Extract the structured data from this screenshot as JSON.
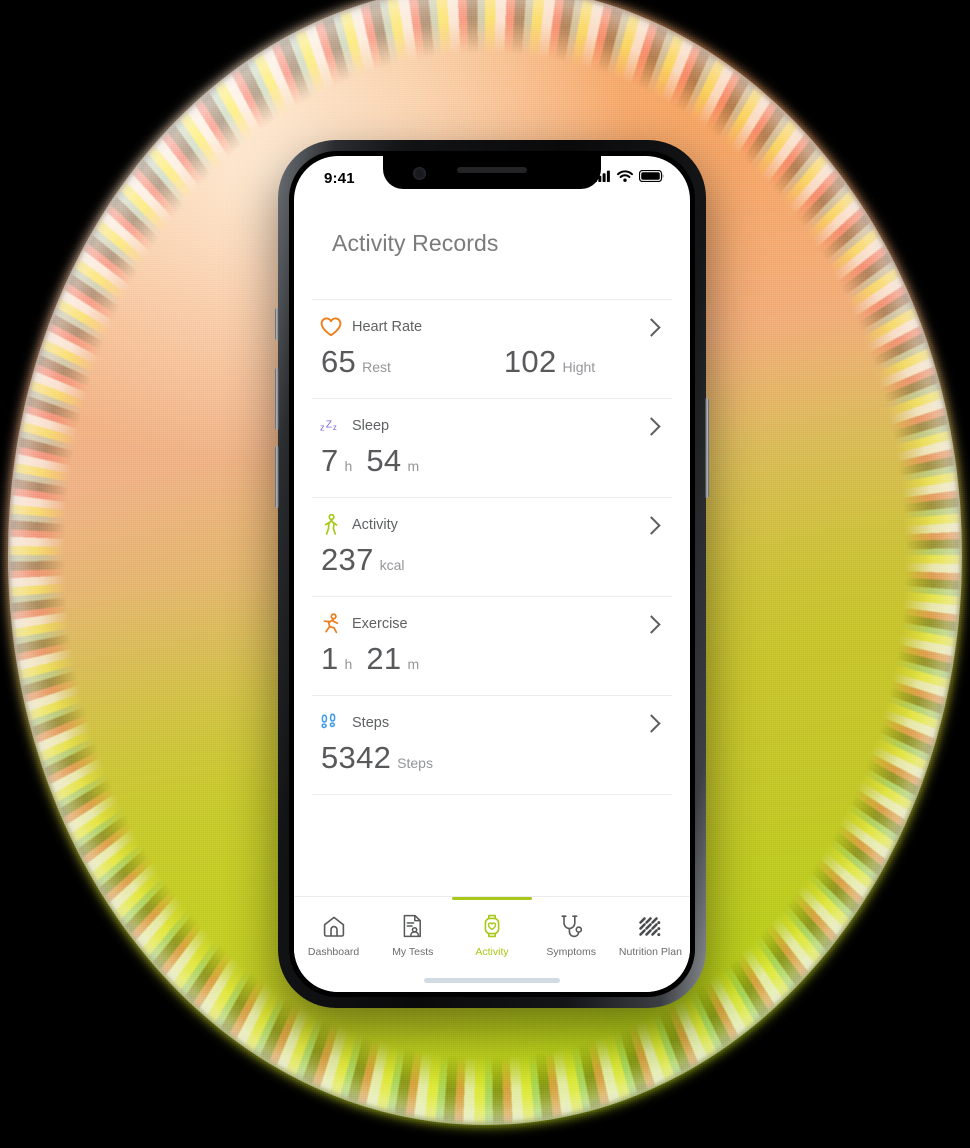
{
  "status_bar": {
    "time": "9:41",
    "icons": [
      "cellular-signal-icon",
      "wifi-icon",
      "battery-icon"
    ]
  },
  "header": {
    "title": "Activity Records"
  },
  "colors": {
    "heart_rate": "#f07d1a",
    "sleep": "#7b68d8",
    "activity": "#a8c91a",
    "exercise": "#f07d1a",
    "steps": "#3d9ae8",
    "accent": "#a8c91a",
    "value_text": "#58595b",
    "unit_text": "#949699",
    "divider": "#eceded",
    "bg_top": "#f4b384",
    "bg_bottom": "#b5d116"
  },
  "records": [
    {
      "id": "heart-rate",
      "label": "Heart Rate",
      "icon": "heart-icon",
      "values": [
        {
          "number": "65",
          "unit": "Rest"
        },
        {
          "number": "102",
          "unit": "Hight"
        }
      ]
    },
    {
      "id": "sleep",
      "label": "Sleep",
      "icon": "zzz-sleep-icon",
      "values": [
        {
          "number": "7",
          "unit": "h"
        },
        {
          "number": "54",
          "unit": "m"
        }
      ]
    },
    {
      "id": "activity",
      "label": "Activity",
      "icon": "walking-person-icon",
      "values": [
        {
          "number": "237",
          "unit": "kcal"
        }
      ]
    },
    {
      "id": "exercise",
      "label": "Exercise",
      "icon": "running-person-icon",
      "values": [
        {
          "number": "1",
          "unit": "h"
        },
        {
          "number": "21",
          "unit": "m"
        }
      ]
    },
    {
      "id": "steps",
      "label": "Steps",
      "icon": "footprints-icon",
      "values": [
        {
          "number": "5342",
          "unit": "Steps"
        }
      ]
    }
  ],
  "tabs": [
    {
      "id": "dashboard",
      "label": "Dashboard",
      "icon": "home-icon",
      "active": false
    },
    {
      "id": "my-tests",
      "label": "My Tests",
      "icon": "document-user-icon",
      "active": false
    },
    {
      "id": "activity",
      "label": "Activity",
      "icon": "smartwatch-heart-icon",
      "active": true
    },
    {
      "id": "symptoms",
      "label": "Symptoms",
      "icon": "stethoscope-icon",
      "active": false
    },
    {
      "id": "nutrition-plan",
      "label": "Nutrition Plan",
      "icon": "nutrition-grid-icon",
      "active": false
    }
  ]
}
